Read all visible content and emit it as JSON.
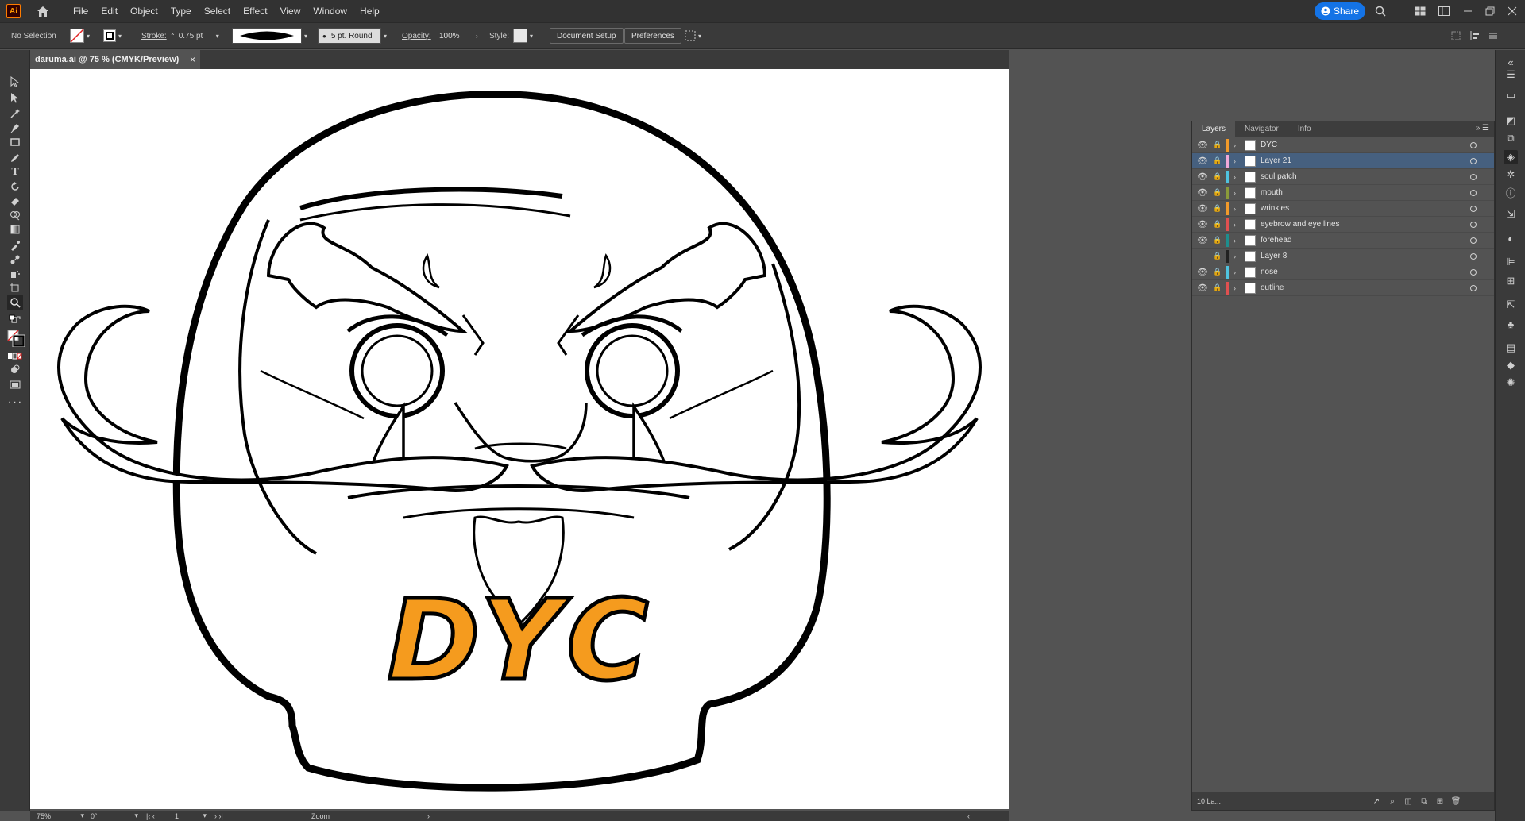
{
  "menubar": {
    "app_logo": "Ai",
    "items": [
      "File",
      "Edit",
      "Object",
      "Type",
      "Select",
      "Effect",
      "View",
      "Window",
      "Help"
    ],
    "share_label": "Share"
  },
  "controlbar": {
    "selection": "No Selection",
    "stroke_label": "Stroke:",
    "stroke_value": "0.75 pt",
    "brush_value": "5 pt. Round",
    "opacity_label": "Opacity:",
    "opacity_value": "100%",
    "style_label": "Style:",
    "document_setup": "Document Setup",
    "preferences": "Preferences"
  },
  "tab": {
    "title": "daruma.ai @ 75 % (CMYK/Preview)",
    "close": "×"
  },
  "statusbar": {
    "zoom": "75%",
    "rotation": "0°",
    "artboard": "1",
    "tool_name": "Zoom"
  },
  "layers_panel": {
    "tabs": [
      "Layers",
      "Navigator",
      "Info"
    ],
    "layers": [
      {
        "name": "DYC",
        "color": "#f29a2a",
        "visible": true,
        "selected": false
      },
      {
        "name": "Layer 21",
        "color": "#f0a8d8",
        "visible": true,
        "selected": true
      },
      {
        "name": "soul patch",
        "color": "#4fc3e0",
        "visible": true,
        "selected": false
      },
      {
        "name": "mouth",
        "color": "#8a9a3a",
        "visible": true,
        "selected": false
      },
      {
        "name": "wrinkles",
        "color": "#f29a2a",
        "visible": true,
        "selected": false
      },
      {
        "name": "eyebrow and eye lines",
        "color": "#e05050",
        "visible": true,
        "selected": false
      },
      {
        "name": "forehead",
        "color": "#1e8e8e",
        "visible": true,
        "selected": false
      },
      {
        "name": "Layer 8",
        "color": "#222222",
        "visible": false,
        "selected": false
      },
      {
        "name": "nose",
        "color": "#4fc3e0",
        "visible": true,
        "selected": false
      },
      {
        "name": "outline",
        "color": "#e05050",
        "visible": true,
        "selected": false
      }
    ],
    "footer_count": "10 La..."
  },
  "artwork": {
    "logo_text": "DYC",
    "logo_color": "#f59b1e"
  }
}
